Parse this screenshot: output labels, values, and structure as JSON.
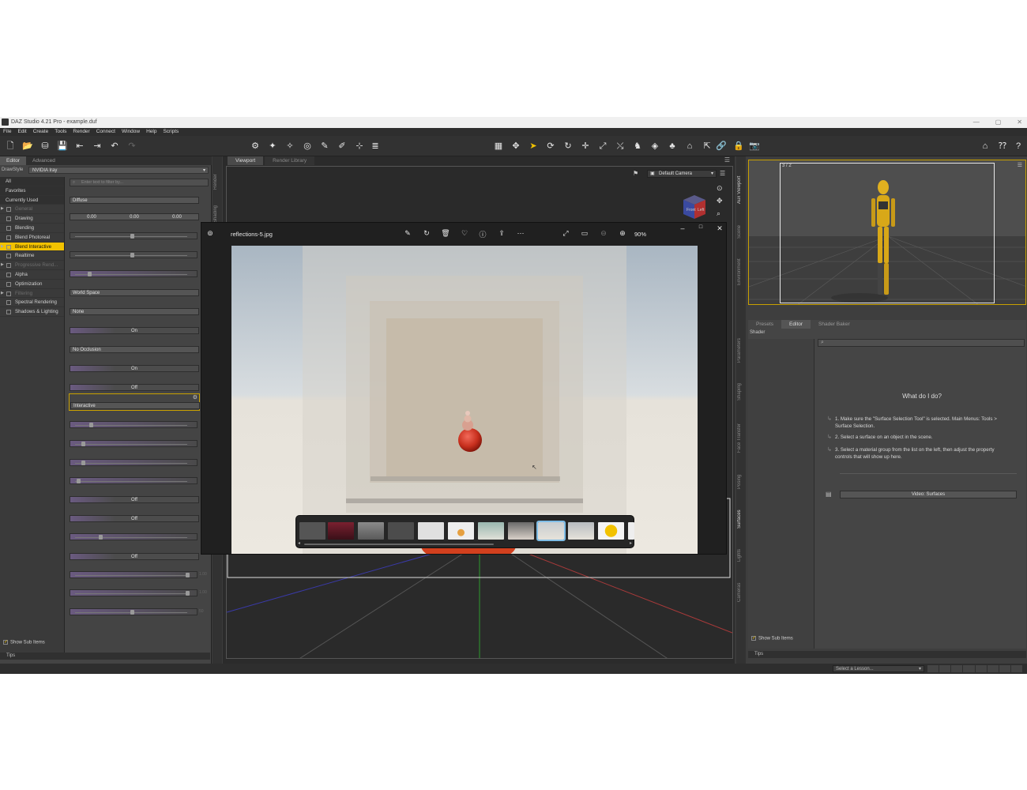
{
  "window": {
    "title": "DAZ Studio 4.21 Pro - example.duf",
    "controls": [
      "—",
      "▢",
      "✕"
    ]
  },
  "menu": [
    "File",
    "Edit",
    "Create",
    "Tools",
    "Render",
    "Connect",
    "Window",
    "Help",
    "Scripts"
  ],
  "left_panel": {
    "tabs": [
      "Editor",
      "Advanced"
    ],
    "drawstyle_label": "DrawStyle",
    "drawstyle_value": "NVIDIA Iray",
    "groups": [
      "All",
      "Favorites",
      "Currently Used"
    ],
    "categories": [
      {
        "label": "General",
        "dim": true,
        "arrow": true
      },
      {
        "label": "Drawing",
        "dim": false,
        "arrow": false
      },
      {
        "label": "Blending",
        "dim": false,
        "arrow": false
      },
      {
        "label": "Blend Photoreal",
        "dim": false,
        "arrow": false
      },
      {
        "label": "Blend Interactive",
        "dim": false,
        "arrow": true,
        "selected": true
      },
      {
        "label": "Realtime",
        "dim": false,
        "arrow": false
      },
      {
        "label": "Progressive Rend...",
        "dim": true,
        "arrow": true
      },
      {
        "label": "Alpha",
        "dim": false,
        "arrow": false
      },
      {
        "label": "Optimization",
        "dim": false,
        "arrow": false
      },
      {
        "label": "Filtering",
        "dim": true,
        "arrow": true
      },
      {
        "label": "Spectral Rendering",
        "dim": false,
        "arrow": false
      },
      {
        "label": "Shadows & Lighting",
        "dim": false,
        "arrow": false
      }
    ],
    "search_placeholder": "Enter text to filter by...",
    "props": {
      "diffuse": "Diffuse",
      "v1": "0.00",
      "v2": "0.00",
      "v3": "0.00",
      "world_space": "World Space",
      "none": "None",
      "on1": "On",
      "no_occlusion": "No Occlusion",
      "on2": "On",
      "off1": "Off",
      "interactive": "Interactive",
      "off2": "Off",
      "off3": "Off",
      "off4": "Off",
      "s1": "1.00",
      "s2": "1.00",
      "s3": "50"
    },
    "show_sub_items": "Show Sub Items",
    "tips": "Tips"
  },
  "left_vtabs": [
    "Render",
    "Shading"
  ],
  "center": {
    "tabs": [
      "Viewport",
      "Render Library"
    ],
    "camera": "Default Camera",
    "navcube_faces": [
      "Front",
      "Left"
    ]
  },
  "right_vtabs": [
    "Aux Viewport",
    "Scene",
    "Environment",
    "Parameters",
    "Shaping",
    "Face Transfer",
    "Posing",
    "Surfaces",
    "Lights",
    "Cameras"
  ],
  "right_panel": {
    "aux_label": "3 / 2",
    "tabs": [
      "Presets",
      "Editor",
      "Shader Baker"
    ],
    "shader_label": "Shader",
    "what_do_i_do": "What do I do?",
    "steps": [
      "1. Make sure the \"Surface Selection Tool\" is selected. Main Menus: Tools > Surface Selection.",
      "2. Select a surface on an object in the scene.",
      "3. Select a material group from the list on the left, then adjust the property controls that will show up here."
    ],
    "video_btn": "Video: Surfaces",
    "show_sub_items": "Show Sub Items",
    "tips": "Tips"
  },
  "status": {
    "lesson_placeholder": "Select a Lesson..."
  },
  "photo_viewer": {
    "filename": "reflections-5.jpg",
    "zoom": "90%",
    "accent_color": "#7fbde6"
  },
  "colors": {
    "selection": "#f2c200",
    "aux_border": "#c8a000"
  }
}
